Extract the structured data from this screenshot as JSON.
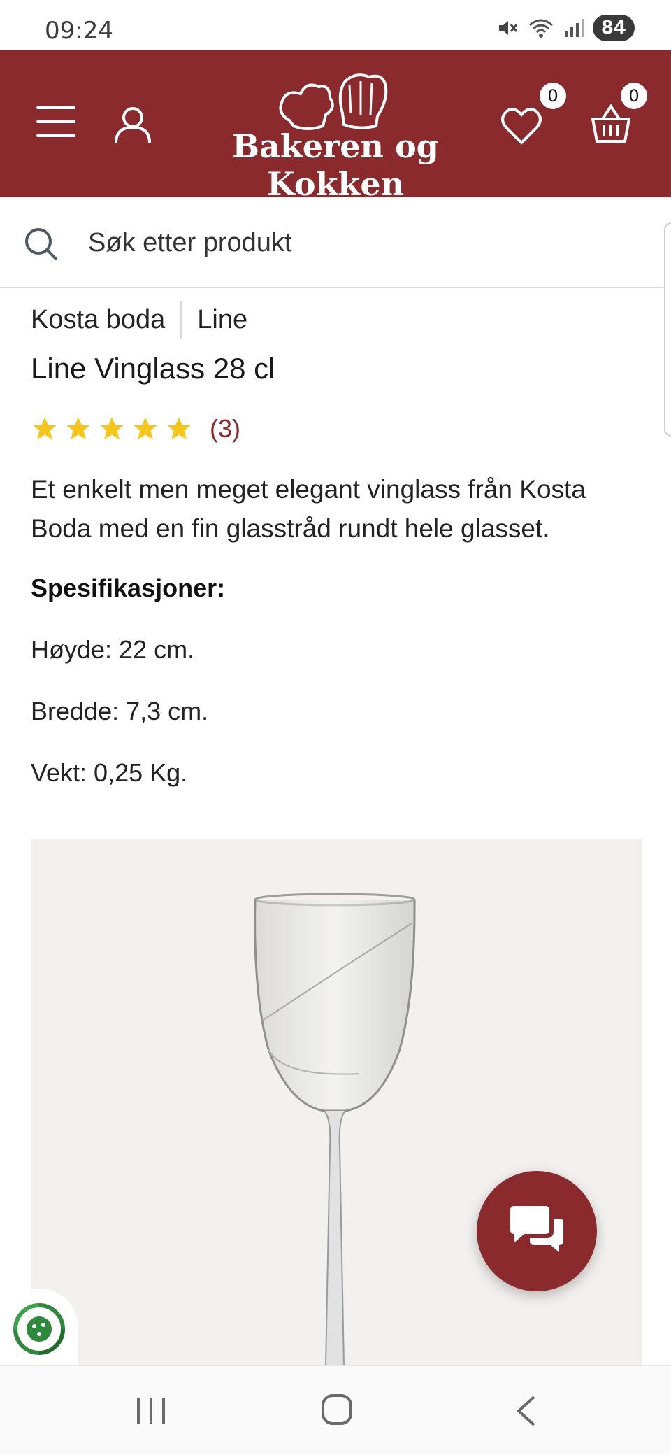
{
  "status_bar": {
    "time": "09:24",
    "battery": "84"
  },
  "header": {
    "logo_text": "Bakeren og Kokken",
    "wishlist_count": "0",
    "cart_count": "0",
    "brand_color": "#8b2a2d"
  },
  "search": {
    "placeholder": "Søk etter produkt"
  },
  "breadcrumb": {
    "brand": "Kosta boda",
    "collection": "Line"
  },
  "product": {
    "title": "Line Vinglass 28 cl",
    "rating_stars": 5,
    "review_count": "(3)",
    "description": "Et enkelt men meget elegant vinglass från Kosta Boda med en fin glasstråd rundt hele glasset.",
    "specs_heading": "Spesifikasjoner:",
    "specs": [
      "Høyde: 22 cm.",
      "Bredde: 7,3 cm.",
      "Vekt: 0,25 Kg."
    ]
  },
  "icons": {
    "menu": "hamburger-menu-icon",
    "account": "user-icon",
    "wishlist": "heart-icon",
    "cart": "basket-icon",
    "search": "search-icon",
    "chat": "chat-bubbles-icon",
    "eco": "recycle-icon"
  }
}
